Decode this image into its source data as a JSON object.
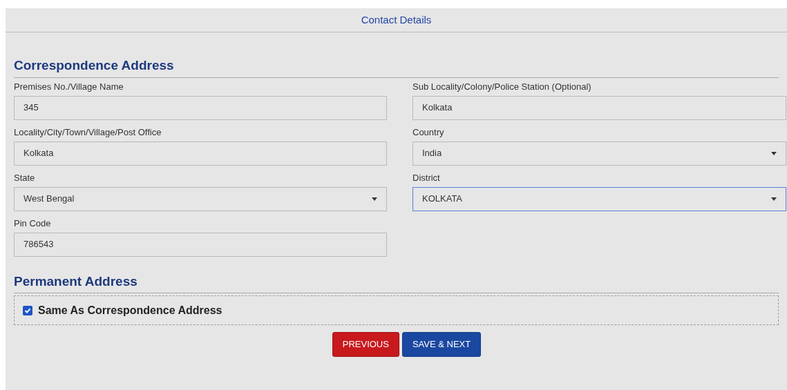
{
  "header": {
    "title": "Contact Details"
  },
  "correspondence": {
    "heading": "Correspondence Address",
    "fields": [
      {
        "label": "Premises No./Village Name",
        "kind": "text",
        "value": "345",
        "focused": false
      },
      {
        "label": "Sub Locality/Colony/Police Station (Optional)",
        "kind": "text",
        "value": "Kolkata",
        "focused": false
      },
      {
        "label": "Locality/City/Town/Village/Post Office",
        "kind": "text",
        "value": "Kolkata",
        "focused": false
      },
      {
        "label": "Country",
        "kind": "select",
        "value": "India",
        "focused": false
      },
      {
        "label": "State",
        "kind": "select",
        "value": "West Bengal",
        "focused": false
      },
      {
        "label": "District",
        "kind": "select",
        "value": "KOLKATA",
        "focused": true
      },
      {
        "label": "Pin Code",
        "kind": "text",
        "value": "786543",
        "focused": false
      }
    ]
  },
  "permanent": {
    "heading": "Permanent Address",
    "same_as": {
      "label": "Same As Correspondence Address",
      "checked": true
    }
  },
  "buttons": [
    {
      "label": "PREVIOUS",
      "kind": "secondary"
    },
    {
      "label": "SAVE & NEXT",
      "kind": "primary"
    }
  ]
}
